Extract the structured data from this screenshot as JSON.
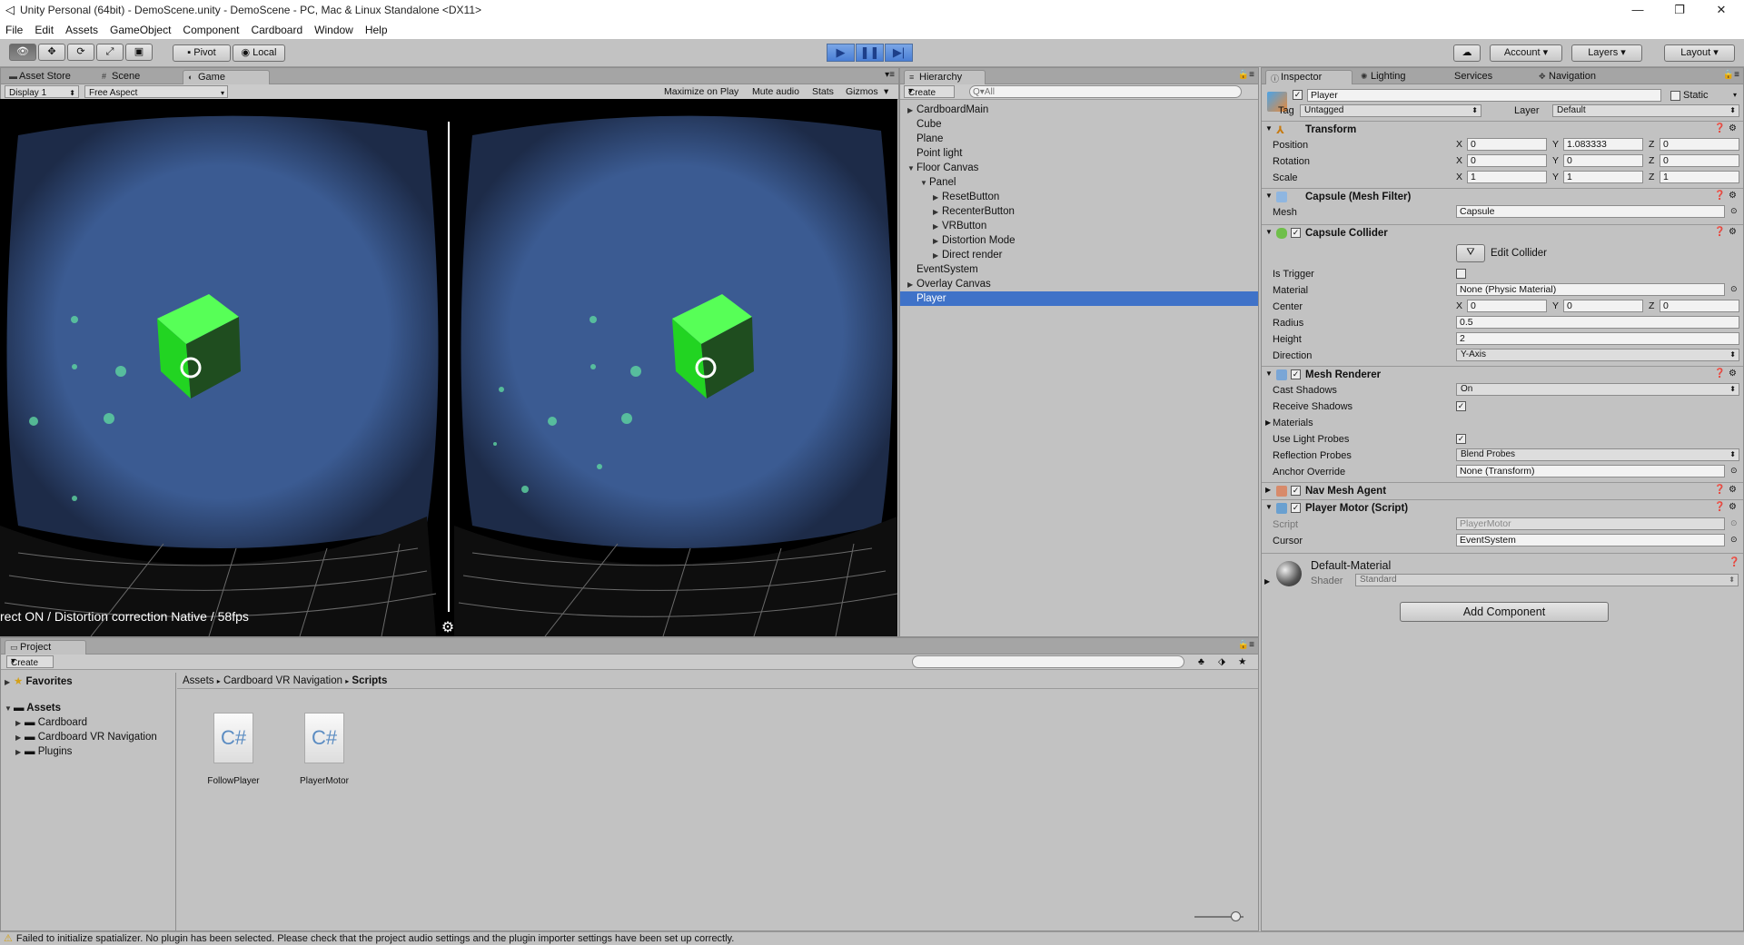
{
  "window": {
    "title": "Unity Personal (64bit) - DemoScene.unity - DemoScene - PC, Mac & Linux Standalone <DX11>",
    "controls": [
      "—",
      "❐",
      "✕"
    ]
  },
  "menu": [
    "File",
    "Edit",
    "Assets",
    "GameObject",
    "Component",
    "Cardboard",
    "Window",
    "Help"
  ],
  "toolbar": {
    "pivot": "Pivot",
    "local": "Local",
    "account": "Account",
    "layers": "Layers",
    "layout": "Layout"
  },
  "scene_tabs": {
    "asset_store": "Asset Store",
    "scene": "Scene",
    "game": "Game",
    "display": "Display 1",
    "aspect": "Free Aspect",
    "maximize": "Maximize on Play",
    "mute": "Mute audio",
    "stats": "Stats",
    "gizmos": "Gizmos",
    "overlay_text": "rect ON / Distortion correction Native / 58fps"
  },
  "hierarchy": {
    "tab": "Hierarchy",
    "create": "Create",
    "search_placeholder": "Q▾All",
    "items": [
      {
        "label": "CardboardMain",
        "indent": 0,
        "arrow": "▶"
      },
      {
        "label": "Cube",
        "indent": 0,
        "arrow": ""
      },
      {
        "label": "Plane",
        "indent": 0,
        "arrow": ""
      },
      {
        "label": "Point light",
        "indent": 0,
        "arrow": ""
      },
      {
        "label": "Floor Canvas",
        "indent": 0,
        "arrow": "▼"
      },
      {
        "label": "Panel",
        "indent": 1,
        "arrow": "▼"
      },
      {
        "label": "ResetButton",
        "indent": 2,
        "arrow": "▶"
      },
      {
        "label": "RecenterButton",
        "indent": 2,
        "arrow": "▶"
      },
      {
        "label": "VRButton",
        "indent": 2,
        "arrow": "▶"
      },
      {
        "label": "Distortion Mode",
        "indent": 2,
        "arrow": "▶"
      },
      {
        "label": "Direct render",
        "indent": 2,
        "arrow": "▶"
      },
      {
        "label": "EventSystem",
        "indent": 0,
        "arrow": ""
      },
      {
        "label": "Overlay Canvas",
        "indent": 0,
        "arrow": "▶"
      },
      {
        "label": "Player",
        "indent": 0,
        "arrow": "",
        "selected": true
      }
    ]
  },
  "inspector": {
    "tabs": {
      "inspector": "Inspector",
      "lighting": "Lighting",
      "services": "Services",
      "navigation": "Navigation"
    },
    "object_name": "Player",
    "static_label": "Static",
    "tag_label": "Tag",
    "tag_value": "Untagged",
    "layer_label": "Layer",
    "layer_value": "Default",
    "transform": {
      "title": "Transform",
      "position_label": "Position",
      "pos": [
        "0",
        "1.083333",
        "0"
      ],
      "rotation_label": "Rotation",
      "rot": [
        "0",
        "0",
        "0"
      ],
      "scale_label": "Scale",
      "scale": [
        "1",
        "1",
        "1"
      ],
      "x": "X",
      "y": "Y",
      "z": "Z"
    },
    "mesh_filter": {
      "title": "Capsule (Mesh Filter)",
      "mesh_label": "Mesh",
      "mesh_value": "Capsule"
    },
    "capsule_collider": {
      "title": "Capsule Collider",
      "edit": "Edit Collider",
      "is_trigger": "Is Trigger",
      "material_label": "Material",
      "material_value": "None (Physic Material)",
      "center_label": "Center",
      "center": [
        "0",
        "0",
        "0"
      ],
      "radius_label": "Radius",
      "radius": "0.5",
      "height_label": "Height",
      "height": "2",
      "direction_label": "Direction",
      "direction": "Y-Axis"
    },
    "mesh_renderer": {
      "title": "Mesh Renderer",
      "cast_label": "Cast Shadows",
      "cast_value": "On",
      "receive_label": "Receive Shadows",
      "materials_label": "Materials",
      "probes_label": "Use Light Probes",
      "refl_label": "Reflection Probes",
      "refl_value": "Blend Probes",
      "anchor_label": "Anchor Override",
      "anchor_value": "None (Transform)"
    },
    "nav_mesh_agent": {
      "title": "Nav Mesh Agent"
    },
    "player_motor": {
      "title": "Player Motor (Script)",
      "script_label": "Script",
      "script_value": "PlayerMotor",
      "cursor_label": "Cursor",
      "cursor_value": "EventSystem"
    },
    "material": {
      "name": "Default-Material",
      "shader_label": "Shader",
      "shader_value": "Standard"
    },
    "add_component": "Add Component"
  },
  "project": {
    "tab": "Project",
    "create": "Create",
    "favorites": "Favorites",
    "assets": "Assets",
    "folders": [
      "Cardboard",
      "Cardboard VR Navigation",
      "Plugins"
    ],
    "breadcrumb": [
      "Assets",
      "Cardboard VR Navigation",
      "Scripts"
    ],
    "files": [
      "FollowPlayer",
      "PlayerMotor"
    ],
    "file_icon": "C#"
  },
  "status": {
    "message": "Failed to initialize spatializer. No plugin has been selected. Please check that the project audio settings and the plugin importer settings have been set up correctly."
  }
}
